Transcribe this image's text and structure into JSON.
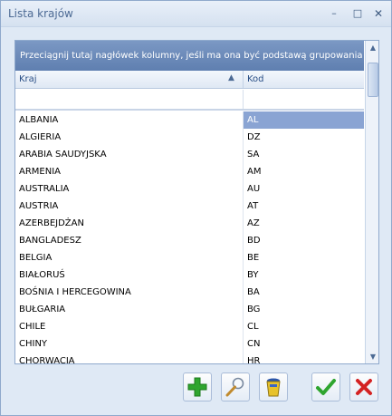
{
  "window": {
    "title": "Lista krajów",
    "minimize_glyph": "–",
    "maximize_glyph": "□",
    "close_glyph": "✕"
  },
  "grid": {
    "group_panel_text": "Przeciągnij tutaj nagłówek kolumny, jeśli ma ona być podstawą grupowania",
    "columns": [
      "Kraj",
      "Kod"
    ],
    "sort_indicator": "▲",
    "rows": [
      {
        "kraj": "ALBANIA",
        "kod": "AL"
      },
      {
        "kraj": "ALGIERIA",
        "kod": "DZ"
      },
      {
        "kraj": "ARABIA SAUDYJSKA",
        "kod": "SA"
      },
      {
        "kraj": "ARMENIA",
        "kod": "AM"
      },
      {
        "kraj": "AUSTRALIA",
        "kod": "AU"
      },
      {
        "kraj": "AUSTRIA",
        "kod": "AT"
      },
      {
        "kraj": "AZERBEJDŻAN",
        "kod": "AZ"
      },
      {
        "kraj": "BANGLADESZ",
        "kod": "BD"
      },
      {
        "kraj": "BELGIA",
        "kod": "BE"
      },
      {
        "kraj": "BIAŁORUŚ",
        "kod": "BY"
      },
      {
        "kraj": "BOŚNIA I HERCEGOWINA",
        "kod": "BA"
      },
      {
        "kraj": "BUŁGARIA",
        "kod": "BG"
      },
      {
        "kraj": "CHILE",
        "kod": "CL"
      },
      {
        "kraj": "CHINY",
        "kod": "CN"
      },
      {
        "kraj": "CHORWACJA",
        "kod": "HR"
      }
    ],
    "selected_row": 0
  },
  "toolbar": {
    "icons": [
      "plus-icon",
      "magnifier-icon",
      "trash-can-icon",
      "checkmark-icon",
      "x-cancel-icon"
    ]
  },
  "colors": {
    "group_panel": "#6b89b9",
    "selection": "#8aa4d3",
    "add_green": "#2fa52f",
    "cancel_red": "#d42222"
  }
}
